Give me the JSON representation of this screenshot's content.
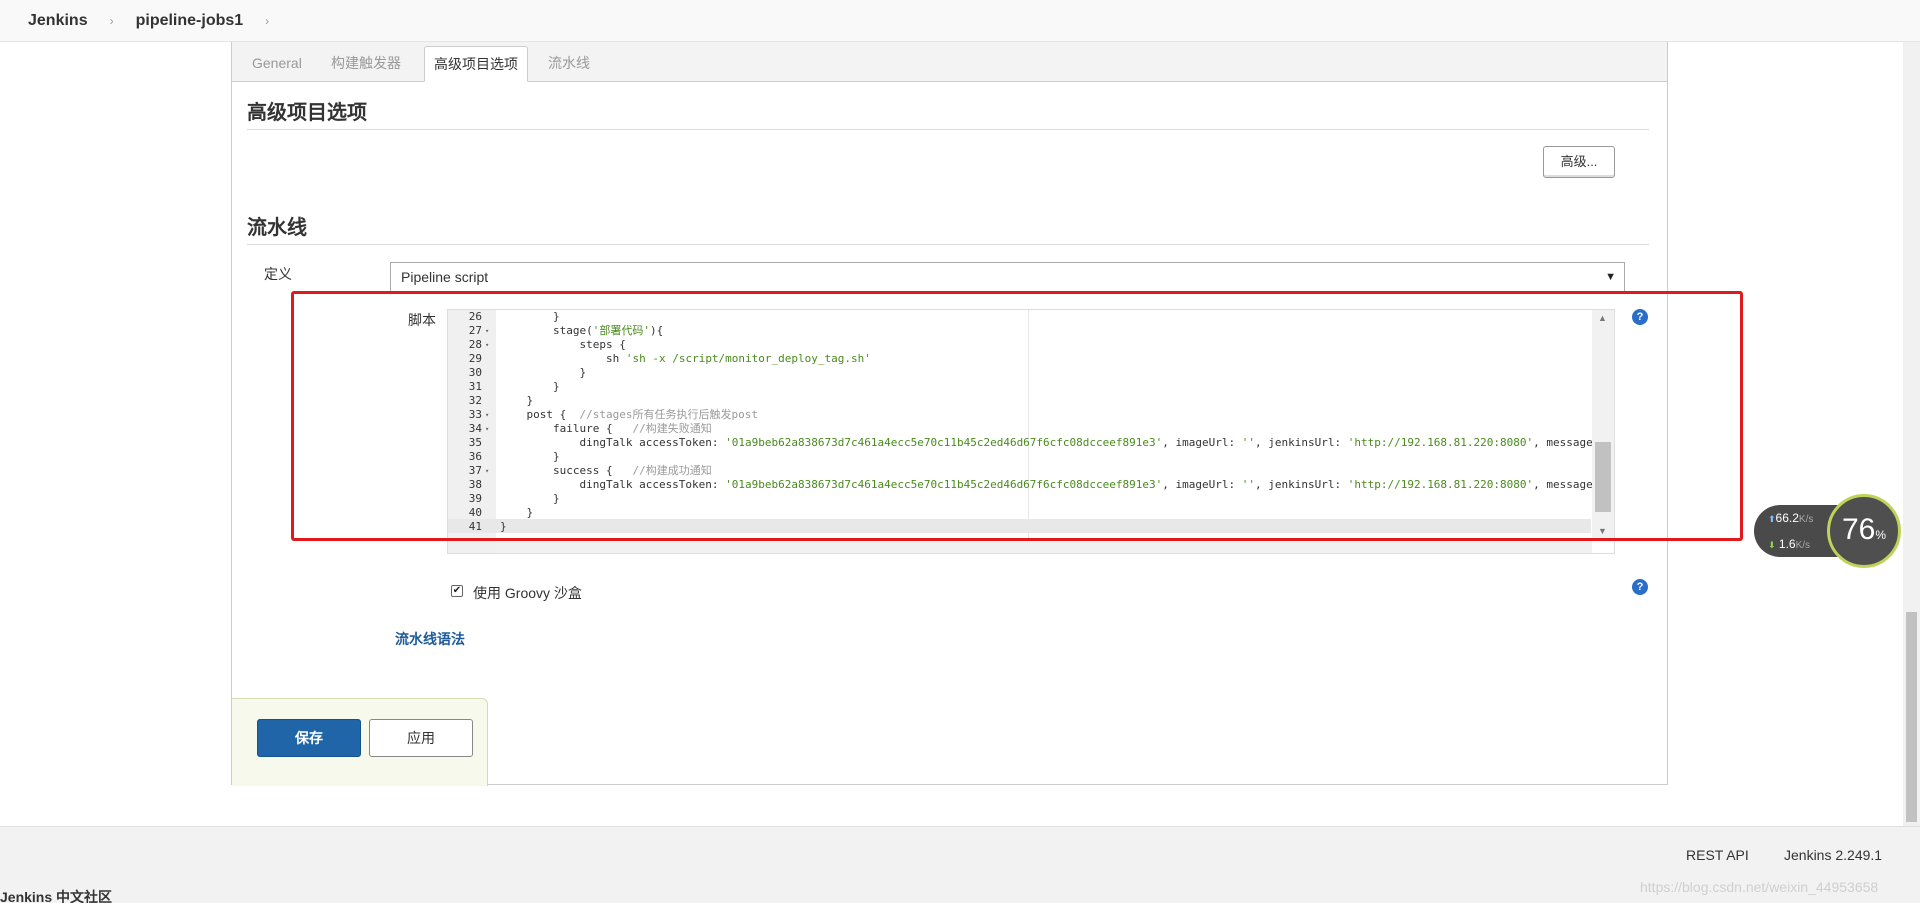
{
  "breadcrumb": {
    "root": "Jenkins",
    "job": "pipeline-jobs1",
    "separator": "›"
  },
  "tabs": [
    {
      "label": "General",
      "active": false
    },
    {
      "label": "构建触发器",
      "active": false
    },
    {
      "label": "高级项目选项",
      "active": true
    },
    {
      "label": "流水线",
      "active": false
    }
  ],
  "advanced_section": {
    "title": "高级项目选项",
    "advanced_button": "高级..."
  },
  "pipeline_section": {
    "title": "流水线",
    "definition_label": "定义",
    "definition_value": "Pipeline script",
    "script_label": "脚本",
    "script_lines": [
      {
        "n": "26",
        "fold": "",
        "text": "        }"
      },
      {
        "n": "27",
        "fold": "▾",
        "text": "        stage('部署代码'){"
      },
      {
        "n": "28",
        "fold": "▾",
        "text": "            steps {"
      },
      {
        "n": "29",
        "fold": "",
        "text": "                sh 'sh -x /script/monitor_deploy_tag.sh'"
      },
      {
        "n": "30",
        "fold": "",
        "text": "            }"
      },
      {
        "n": "31",
        "fold": "",
        "text": "        }"
      },
      {
        "n": "32",
        "fold": "",
        "text": "    }"
      },
      {
        "n": "33",
        "fold": "▾",
        "text": "    post {  //stages所有任务执行后触发post"
      },
      {
        "n": "34",
        "fold": "▾",
        "text": "        failure {   //构建失败通知"
      },
      {
        "n": "35",
        "fold": "",
        "text": "            dingTalk accessToken: '01a9beb62a838673d7c461a4ecc5e70c11b45c2ed46d67f6cfc08dcceef891e3', imageUrl: '', jenkinsUrl: 'http://192.168.81.220:8080', message:"
      },
      {
        "n": "36",
        "fold": "",
        "text": "        }"
      },
      {
        "n": "37",
        "fold": "▾",
        "text": "        success {   //构建成功通知"
      },
      {
        "n": "38",
        "fold": "",
        "text": "            dingTalk accessToken: '01a9beb62a838673d7c461a4ecc5e70c11b45c2ed46d67f6cfc08dcceef891e3', imageUrl: '', jenkinsUrl: 'http://192.168.81.220:8080', message:"
      },
      {
        "n": "39",
        "fold": "",
        "text": "        }"
      },
      {
        "n": "40",
        "fold": "",
        "text": "    }"
      },
      {
        "n": "41",
        "fold": "",
        "text": "}"
      }
    ],
    "groovy_sandbox_label": "使用 Groovy 沙盒",
    "groovy_sandbox_checked": true,
    "syntax_link": "流水线语法"
  },
  "help_glyph": "?",
  "checkbox_glyph": "✔",
  "actions": {
    "save": "保存",
    "apply": "应用"
  },
  "footer": {
    "rest_api": "REST API",
    "version": "Jenkins 2.249.1",
    "community": "Jenkins 中文社区",
    "watermark": "https://blog.csdn.net/weixin_44953658"
  },
  "network_widget": {
    "upload": "66.2",
    "download": "1.6",
    "unit": "K/s",
    "percent": "76",
    "percent_sign": "%",
    "ring_color": "#bfd35a"
  },
  "colors": {
    "highlight_border": "#e0191d",
    "primary_button": "#1f65a7",
    "link": "#1d5b9a",
    "help_icon": "#2a6ec7"
  }
}
